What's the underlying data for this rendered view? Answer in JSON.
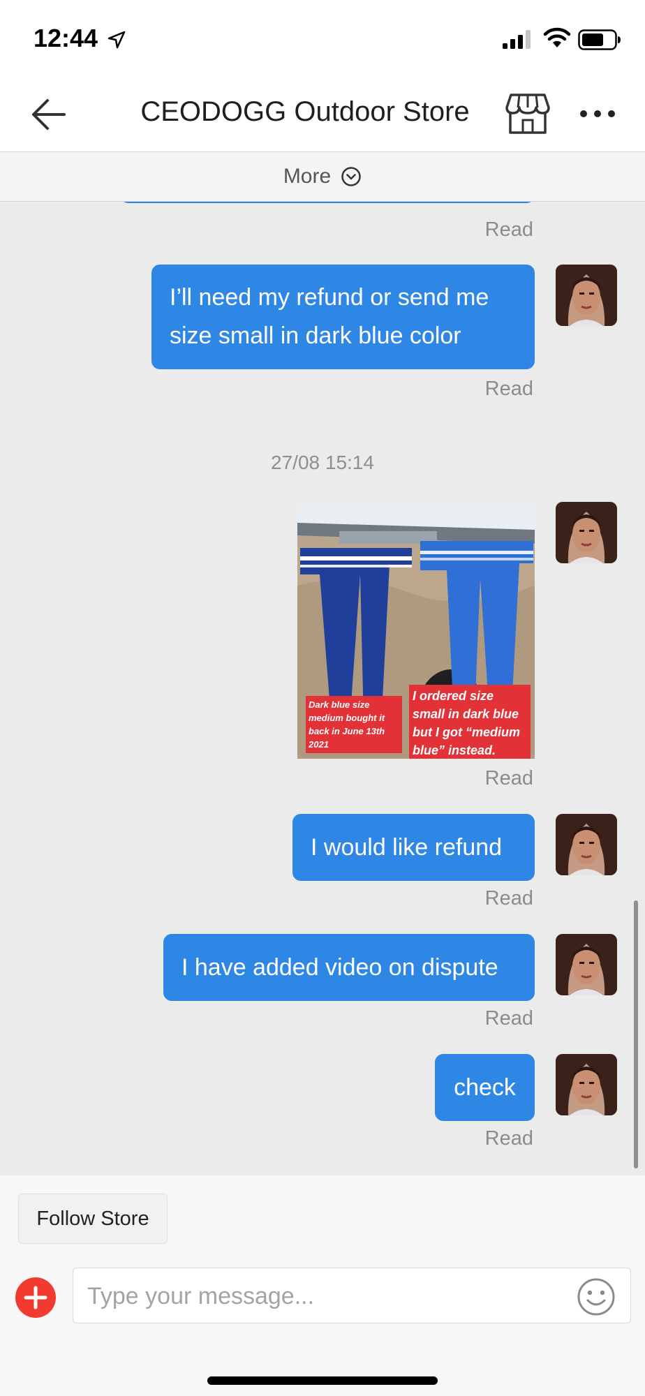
{
  "status_bar": {
    "time": "12:44"
  },
  "header": {
    "title": "CEODOGG Outdoor Store",
    "icons": [
      "back-arrow-icon",
      "store-icon",
      "ellipsis-icon"
    ]
  },
  "more_bar": {
    "label": "More"
  },
  "messages": [
    {
      "type": "text",
      "lines": [
        "I’ll need my refund or send me",
        "size small in dark blue color"
      ],
      "status": "Read"
    },
    {
      "type": "timestamp",
      "text": "27/08 15:14"
    },
    {
      "type": "image",
      "caption_left": "Dark blue size medium bought it back in June 13th 2021",
      "caption_right": "I ordered size small in dark blue but I got “medium blue” instead.",
      "status": "Read"
    },
    {
      "type": "text",
      "text": "I would like refund",
      "status": "Read"
    },
    {
      "type": "text",
      "text": "I have added video on dispute",
      "status": "Read"
    },
    {
      "type": "text",
      "text": "check",
      "status": "Read"
    }
  ],
  "previous_status": "Read",
  "footer": {
    "follow_label": "Follow Store",
    "input_placeholder": "Type your message...",
    "input_value": ""
  },
  "colors": {
    "bubble": "#2f87e5",
    "background": "#ebebec",
    "add_button": "#f23b2f"
  }
}
